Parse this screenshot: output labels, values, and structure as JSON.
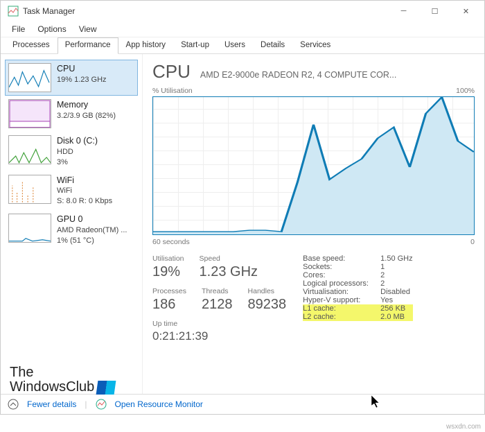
{
  "window": {
    "title": "Task Manager"
  },
  "menu": {
    "file": "File",
    "options": "Options",
    "view": "View"
  },
  "tabs": [
    "Processes",
    "Performance",
    "App history",
    "Start-up",
    "Users",
    "Details",
    "Services"
  ],
  "tabs_active_index": 1,
  "sidebar": {
    "items": [
      {
        "name": "CPU",
        "sub1": "19% 1.23 GHz"
      },
      {
        "name": "Memory",
        "sub1": "3.2/3.9 GB (82%)"
      },
      {
        "name": "Disk 0 (C:)",
        "sub1": "HDD",
        "sub2": "3%"
      },
      {
        "name": "WiFi",
        "sub1": "WiFi",
        "sub2": "S: 8.0 R: 0 Kbps"
      },
      {
        "name": "GPU 0",
        "sub1": "AMD Radeon(TM) ...",
        "sub2": "1% (51 °C)"
      }
    ]
  },
  "main": {
    "title": "CPU",
    "subtitle": "AMD E2-9000e RADEON R2, 4 COMPUTE COR...",
    "chart": {
      "top_left": "% Utilisation",
      "top_right": "100%",
      "bottom_left": "60 seconds",
      "bottom_right": "0"
    },
    "stat_labels": {
      "util": "Utilisation",
      "speed": "Speed",
      "proc": "Processes",
      "threads": "Threads",
      "handles": "Handles",
      "uptime": "Up time"
    },
    "stat_values": {
      "util": "19%",
      "speed": "1.23 GHz",
      "proc": "186",
      "threads": "2128",
      "handles": "89238",
      "uptime": "0:21:21:39"
    },
    "spec_labels": {
      "base": "Base speed:",
      "sockets": "Sockets:",
      "cores": "Cores:",
      "logical": "Logical processors:",
      "virt": "Virtualisation:",
      "hyperv": "Hyper-V support:",
      "l1": "L1 cache:",
      "l2": "L2 cache:"
    },
    "spec_values": {
      "base": "1.50 GHz",
      "sockets": "1",
      "cores": "2",
      "logical": "2",
      "virt": "Disabled",
      "hyperv": "Yes",
      "l1": "256 KB",
      "l2": "2.0 MB"
    }
  },
  "footer": {
    "fewer": "Fewer details",
    "orm": "Open Resource Monitor"
  },
  "watermark": {
    "l1": "The",
    "l2": "WindowsClub"
  },
  "siteref": "wsxdn.com",
  "chart_data": {
    "type": "line",
    "title": "% Utilisation",
    "xlabel": "seconds",
    "ylabel": "% Utilisation",
    "xlim": [
      60,
      0
    ],
    "ylim": [
      0,
      100
    ],
    "x": [
      60,
      57,
      54,
      51,
      48,
      45,
      42,
      39,
      36,
      33,
      30,
      27,
      24,
      21,
      18,
      15,
      12,
      9,
      6,
      3,
      0
    ],
    "values": [
      2,
      2,
      2,
      2,
      2,
      2,
      3,
      3,
      2,
      38,
      80,
      40,
      48,
      55,
      70,
      78,
      49,
      88,
      100,
      68,
      60
    ]
  },
  "colors": {
    "cpu": "#0f7cb5",
    "mem": "#a23db0",
    "disk": "#3fa038",
    "wifi": "#d97a24",
    "gpu": "#0f7cb5"
  }
}
